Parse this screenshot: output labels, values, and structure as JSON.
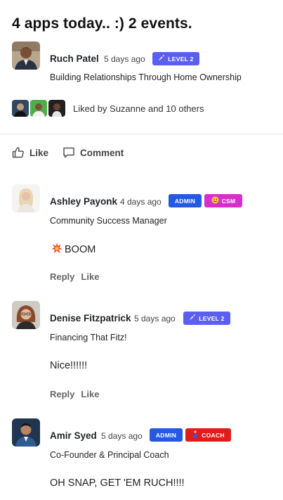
{
  "post": {
    "title": "4 apps today.. :) 2 events.",
    "author": {
      "name": "Ruch Patel",
      "time": "5 days ago",
      "badge": "LEVEL 2",
      "subtitle": "Building Relationships Through Home Ownership",
      "avatar_icon": "avatar-ruch-patel"
    },
    "likes": {
      "text": "Liked by Suzanne and 10 others",
      "avatars": [
        "liker-1",
        "liker-2",
        "liker-3"
      ]
    },
    "actions": {
      "like_label": "Like",
      "comment_label": "Comment"
    }
  },
  "comments": [
    {
      "name": "Ashley Payonk",
      "time": "4 days ago",
      "badges": [
        "ADMIN",
        "CSM"
      ],
      "badge_icons": [
        "",
        "smile-emoji-icon"
      ],
      "subtitle": "Community Success Manager",
      "body": "BOOM",
      "body_icon": "collision-emoji-icon",
      "reply_label": "Reply",
      "like_label": "Like"
    },
    {
      "name": "Denise Fitzpatrick",
      "time": "5 days ago",
      "badges": [
        "LEVEL 2"
      ],
      "badge_icons": [
        "rocket-icon"
      ],
      "subtitle": "Financing That Fitz!",
      "body": "Nice!!!!!!",
      "reply_label": "Reply",
      "like_label": "Like"
    },
    {
      "name": "Amir Syed",
      "time": "5 days ago",
      "badges": [
        "ADMIN",
        "COACH"
      ],
      "badge_icons": [
        "",
        "coach-figure-icon"
      ],
      "subtitle": "Co-Founder & Principal Coach",
      "body": "OH SNAP, GET 'EM RUCH!!!!"
    }
  ],
  "colors": {
    "level_badge": "#5b5ff0",
    "admin_badge": "#2459e0",
    "csm_badge": "#d531c9",
    "coach_badge": "#e21b1b",
    "divider": "#e3e3e3"
  }
}
